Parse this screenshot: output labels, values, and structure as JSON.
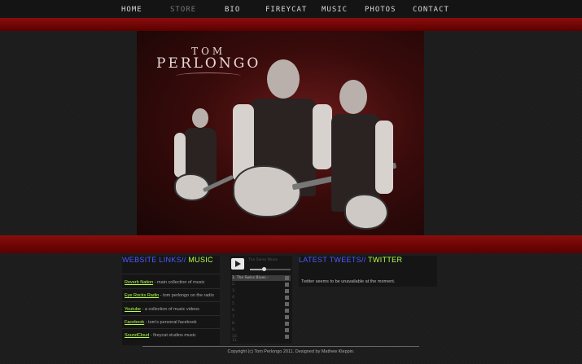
{
  "nav": {
    "items": [
      "HOME",
      "STORE",
      "BIO",
      "FIREYCAT",
      "MUSIC",
      "PHOTOS",
      "CONTACT"
    ]
  },
  "hero": {
    "logo_line1": "TOM",
    "logo_line2": "PERLONGO"
  },
  "links_panel": {
    "heading_a": "WEBSITE LINKS//",
    "heading_b": "MUSIC",
    "items": [
      {
        "link": "Reverb Nation",
        "desc": " - main collection of music"
      },
      {
        "link": "Eye Rocks Radio",
        "desc": " - tom perlongo on the radio"
      },
      {
        "link": "Youtube",
        "desc": " - a collection of music videos"
      },
      {
        "link": "Facebook",
        "desc": " - tom's personal facebook"
      },
      {
        "link": "SoundCloud",
        "desc": " - fireycat studios music"
      }
    ]
  },
  "player": {
    "now_playing": "The Swiss Blues",
    "tracks": [
      "1. The Swiss Blues -",
      "2.",
      "3.",
      "4.",
      "5.",
      "6.",
      "7.",
      "8.",
      "9.",
      "10.",
      "11."
    ],
    "progress": 0.3
  },
  "tweets_panel": {
    "heading_a": "LATEST TWEETS//",
    "heading_b": "TWITTER",
    "message": "Twitter seems to be unavailable at the moment."
  },
  "footer": {
    "text": "Copyright (c) Tom Perlongo 2011. Designed by Mathew Kleppin."
  },
  "colors": {
    "band_red": "#8a0d0d",
    "heading_blue": "#4a5cff",
    "heading_green": "#b5ff4a"
  }
}
